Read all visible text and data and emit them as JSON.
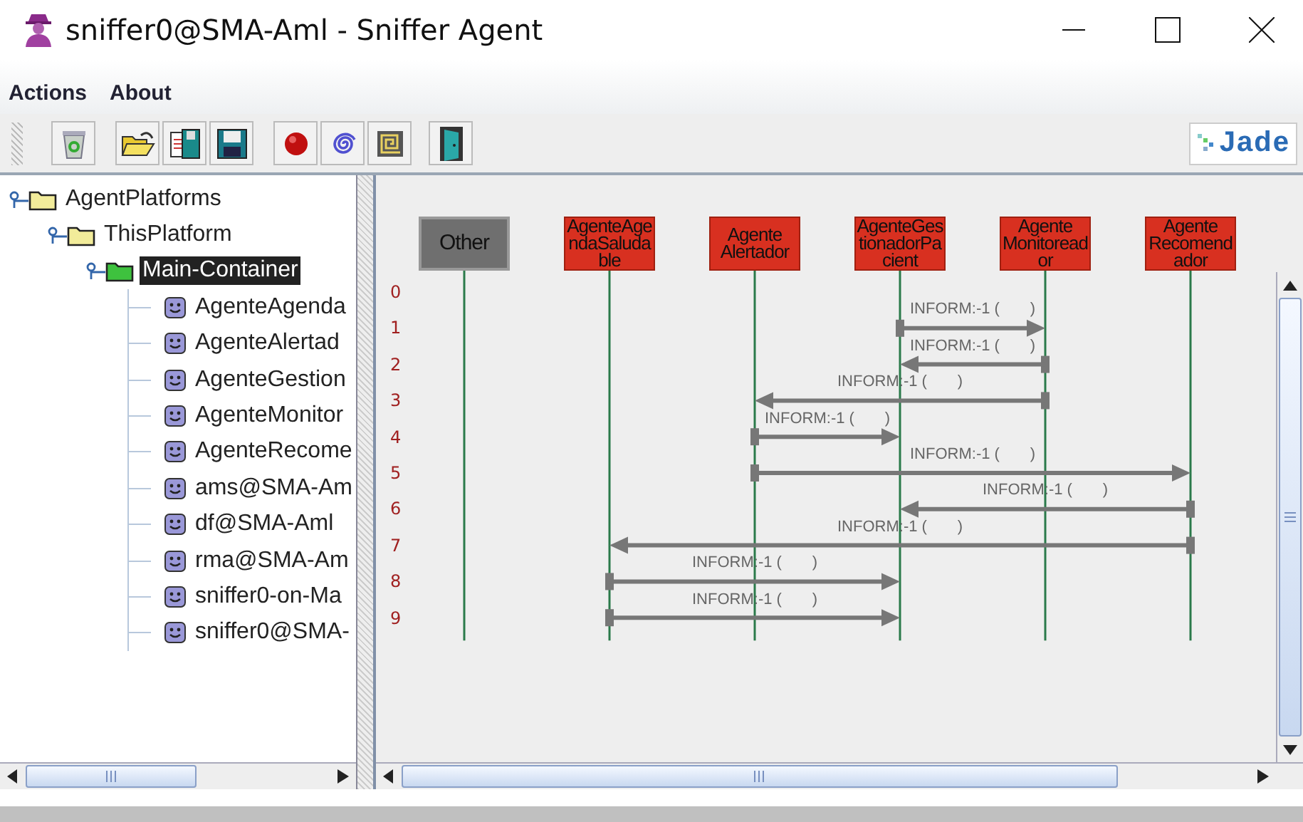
{
  "window": {
    "title": "sniffer0@SMA-Aml - Sniffer Agent"
  },
  "menu": [
    "Actions",
    "About"
  ],
  "toolbar": [
    [
      {
        "kind": "trash"
      }
    ],
    [
      {
        "kind": "open"
      },
      {
        "kind": "saveas"
      },
      {
        "kind": "save"
      }
    ],
    [
      {
        "kind": "record"
      },
      {
        "kind": "spiral"
      },
      {
        "kind": "square-spiral"
      }
    ],
    [
      {
        "kind": "exit"
      }
    ]
  ],
  "logo": "Jade",
  "tree": [
    {
      "label": "AgentPlatforms",
      "kind": "folder",
      "expanded": true,
      "selected": false,
      "children": [
        {
          "label": "ThisPlatform",
          "kind": "folder",
          "expanded": true,
          "selected": false,
          "children": [
            {
              "label": "Main-Container",
              "kind": "container",
              "expanded": true,
              "selected": true,
              "children": [
                {
                  "label": "AgenteAgenda",
                  "kind": "agent",
                  "selected": false
                },
                {
                  "label": "AgenteAlertad",
                  "kind": "agent",
                  "selected": false
                },
                {
                  "label": "AgenteGestion",
                  "kind": "agent",
                  "selected": false
                },
                {
                  "label": "AgenteMonitor",
                  "kind": "agent",
                  "selected": false
                },
                {
                  "label": "AgenteRecome",
                  "kind": "agent",
                  "selected": false
                },
                {
                  "label": "ams@SMA-Am",
                  "kind": "agent",
                  "selected": false
                },
                {
                  "label": "df@SMA-Aml",
                  "kind": "agent",
                  "selected": false
                },
                {
                  "label": "rma@SMA-Am",
                  "kind": "agent",
                  "selected": false
                },
                {
                  "label": "sniffer0-on-Ma",
                  "kind": "agent",
                  "selected": false
                },
                {
                  "label": "sniffer0@SMA-",
                  "kind": "agent",
                  "selected": false
                }
              ]
            }
          ]
        }
      ]
    }
  ],
  "agents": [
    {
      "name": "Other",
      "kind": "other"
    },
    {
      "name": "AgenteAgendaSaludable",
      "kind": "agent"
    },
    {
      "name": "Agente Alertador",
      "kind": "agent"
    },
    {
      "name": "AgenteGestionadorPacient",
      "kind": "agent"
    },
    {
      "name": "Agente Monitoreador",
      "kind": "agent"
    },
    {
      "name": "Agente Recomendador",
      "kind": "agent"
    }
  ],
  "rows": [
    {
      "number": "0"
    },
    {
      "number": "1",
      "message": {
        "label": "INFORM:-1 (       )",
        "lanes": [
          {
            "kind": "none"
          },
          {
            "kind": "none"
          },
          {
            "kind": "none"
          },
          {
            "kind": "source"
          },
          {
            "kind": "target"
          },
          {
            "kind": "none"
          }
        ]
      }
    },
    {
      "number": "2",
      "message": {
        "label": "INFORM:-1 (       )",
        "lanes": [
          {
            "kind": "none"
          },
          {
            "kind": "none"
          },
          {
            "kind": "none"
          },
          {
            "kind": "target"
          },
          {
            "kind": "source"
          },
          {
            "kind": "none"
          }
        ]
      }
    },
    {
      "number": "3",
      "message": {
        "label": "INFORM:-1 (       )",
        "lanes": [
          {
            "kind": "none"
          },
          {
            "kind": "none"
          },
          {
            "kind": "target"
          },
          {
            "kind": "none"
          },
          {
            "kind": "source"
          },
          {
            "kind": "none"
          }
        ]
      }
    },
    {
      "number": "4",
      "message": {
        "label": "INFORM:-1 (       )",
        "lanes": [
          {
            "kind": "none"
          },
          {
            "kind": "none"
          },
          {
            "kind": "source"
          },
          {
            "kind": "target"
          },
          {
            "kind": "none"
          },
          {
            "kind": "none"
          }
        ]
      }
    },
    {
      "number": "5",
      "message": {
        "label": "INFORM:-1 (       )",
        "lanes": [
          {
            "kind": "none"
          },
          {
            "kind": "none"
          },
          {
            "kind": "source"
          },
          {
            "kind": "none"
          },
          {
            "kind": "none"
          },
          {
            "kind": "target"
          }
        ]
      }
    },
    {
      "number": "6",
      "message": {
        "label": "INFORM:-1 (       )",
        "lanes": [
          {
            "kind": "none"
          },
          {
            "kind": "none"
          },
          {
            "kind": "none"
          },
          {
            "kind": "target"
          },
          {
            "kind": "none"
          },
          {
            "kind": "source"
          }
        ]
      }
    },
    {
      "number": "7",
      "message": {
        "label": "INFORM:-1 (       )",
        "lanes": [
          {
            "kind": "none"
          },
          {
            "kind": "target"
          },
          {
            "kind": "none"
          },
          {
            "kind": "none"
          },
          {
            "kind": "none"
          },
          {
            "kind": "source"
          }
        ]
      }
    },
    {
      "number": "8",
      "message": {
        "label": "INFORM:-1 (       )",
        "lanes": [
          {
            "kind": "none"
          },
          {
            "kind": "source"
          },
          {
            "kind": "none"
          },
          {
            "kind": "target"
          },
          {
            "kind": "none"
          },
          {
            "kind": "none"
          }
        ]
      }
    },
    {
      "number": "9",
      "message": {
        "label": "INFORM:-1 (       )",
        "lanes": [
          {
            "kind": "none"
          },
          {
            "kind": "source"
          },
          {
            "kind": "none"
          },
          {
            "kind": "target"
          },
          {
            "kind": "none"
          },
          {
            "kind": "none"
          }
        ]
      }
    }
  ]
}
